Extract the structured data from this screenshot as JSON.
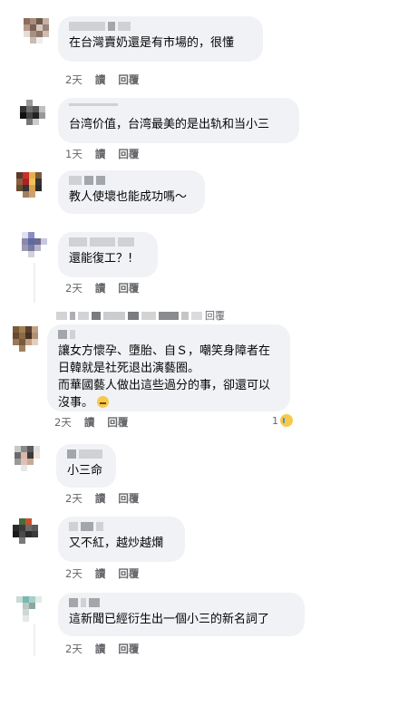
{
  "comments": [
    {
      "text": "在台灣賣奶還是有市場的，很懂",
      "time": "2天",
      "read": "讀",
      "reply": "回覆"
    },
    {
      "text": "台湾价值，台湾最美的是出轨和当小三",
      "time": "1天",
      "read": "讀",
      "reply": "回覆"
    },
    {
      "text": "教人使壞也能成功嗎～"
    },
    {
      "text": "還能復工？!",
      "time": "2天",
      "read": "讀",
      "reply": "回覆"
    },
    {
      "reply_label": "回覆"
    },
    {
      "text": "讓女方懷孕、墮胎、自Ｓ，嘲笑身障者在日韓就是社死退出演藝圈。\n而華國藝人做出這些過分的事，卻還可以沒事。",
      "time": "2天",
      "read": "讀",
      "reply": "回覆",
      "reaction_count": "1",
      "emoji": "neutral-face-emoji",
      "reaction_icon": "sad-reaction-icon"
    },
    {
      "text": "小三命",
      "time": "2天",
      "read": "讀",
      "reply": "回覆"
    },
    {
      "text": "又不紅，越炒越爛",
      "time": "2天",
      "read": "讀",
      "reply": "回覆"
    },
    {
      "text": "這新聞已經衍生出一個小三的新名詞了",
      "time": "2天",
      "read": "讀",
      "reply": "回覆"
    }
  ],
  "colors": {
    "bubble": "#f0f2f5",
    "meta": "#65676b",
    "text": "#050505"
  }
}
